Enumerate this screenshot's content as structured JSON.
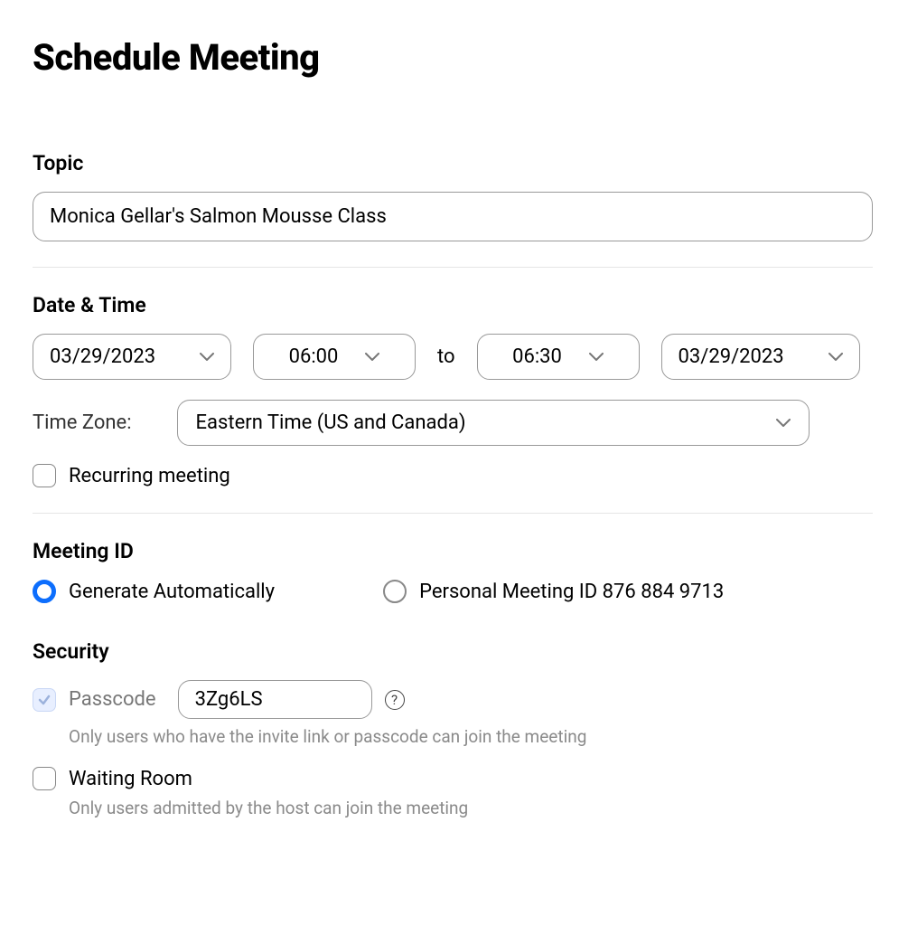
{
  "page_title": "Schedule Meeting",
  "topic": {
    "label": "Topic",
    "value": "Monica Gellar's Salmon Mousse Class"
  },
  "datetime": {
    "label": "Date & Time",
    "start_date": "03/29/2023",
    "start_time": "06:00",
    "to_text": "to",
    "end_time": "06:30",
    "end_date": "03/29/2023",
    "timezone_label": "Time Zone:",
    "timezone_value": "Eastern Time (US and Canada)",
    "recurring_label": "Recurring meeting",
    "recurring_checked": false
  },
  "meeting_id": {
    "label": "Meeting ID",
    "auto_label": "Generate Automatically",
    "auto_selected": true,
    "personal_label": "Personal Meeting ID 876 884 9713",
    "personal_selected": false
  },
  "security": {
    "label": "Security",
    "passcode_label": "Passcode",
    "passcode_value": "3Zg6LS",
    "passcode_checked_locked": true,
    "passcode_hint": "Only users who have the invite link or passcode can join the meeting",
    "waiting_room_label": "Waiting Room",
    "waiting_room_checked": false,
    "waiting_room_hint": "Only users admitted by the host can join the meeting"
  }
}
